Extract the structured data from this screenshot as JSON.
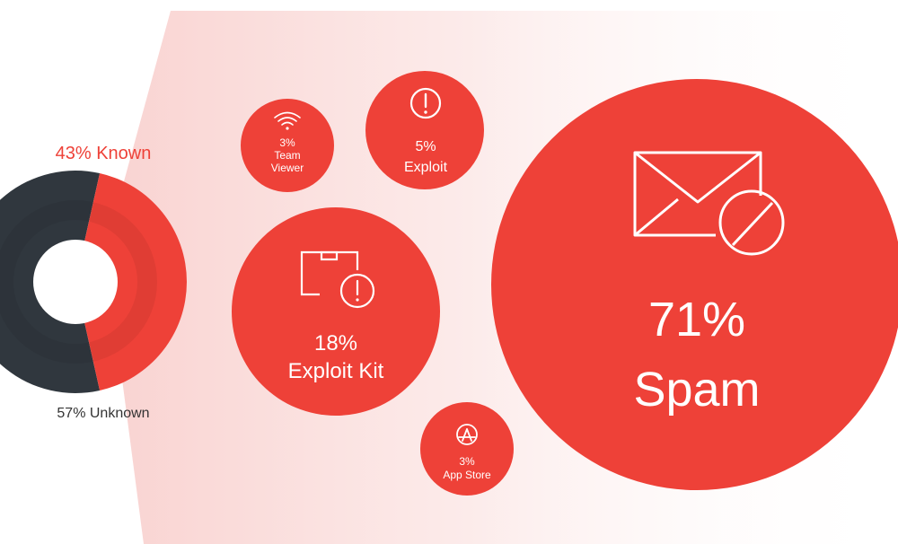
{
  "colors": {
    "accent_red": "#EE4138",
    "dark_slate": "#30373E",
    "label_gray": "#333333",
    "fan_light": "#FCE6E5"
  },
  "donut": {
    "known_label": "43% Known",
    "unknown_label": "57% Unknown"
  },
  "bubbles": [
    {
      "id": "team-viewer",
      "percent": "3%",
      "label_lines": [
        "Team",
        "Viewer"
      ],
      "icon": "wifi-icon",
      "value": 3
    },
    {
      "id": "exploit",
      "percent": "5%",
      "label_lines": [
        "Exploit"
      ],
      "icon": "exclamation-circle-icon",
      "value": 5
    },
    {
      "id": "exploit-kit",
      "percent": "18%",
      "label_lines": [
        "Exploit Kit"
      ],
      "icon": "package-alert-icon",
      "value": 18
    },
    {
      "id": "app-store",
      "percent": "3%",
      "label_lines": [
        "App Store"
      ],
      "icon": "app-store-icon",
      "value": 3
    },
    {
      "id": "spam",
      "percent": "71%",
      "label_lines": [
        "Spam"
      ],
      "icon": "blocked-mail-icon",
      "value": 71
    }
  ],
  "chart_data": [
    {
      "type": "pie",
      "categories": [
        "Known",
        "Unknown"
      ],
      "values": [
        43,
        57
      ],
      "colors": [
        "#EE4138",
        "#30373E"
      ]
    },
    {
      "type": "scatter",
      "categories": [
        "Team Viewer",
        "Exploit",
        "Exploit Kit",
        "App Store",
        "Spam"
      ],
      "values": [
        3,
        5,
        18,
        3,
        71
      ]
    }
  ]
}
